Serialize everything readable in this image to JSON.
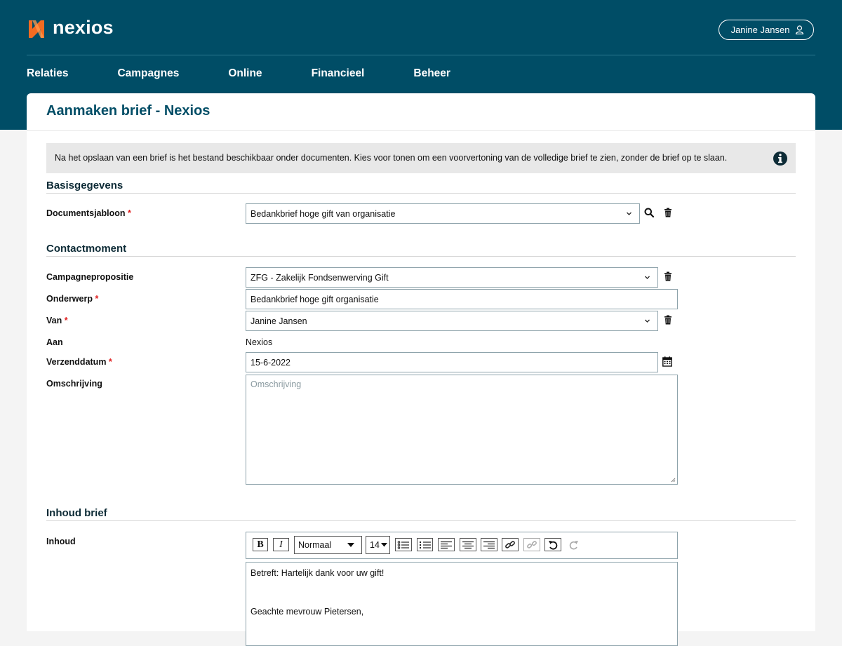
{
  "brand": {
    "name": "nexios",
    "accent": "#f26b21",
    "header_bg": "#004d66"
  },
  "user": {
    "name": "Janine Jansen",
    "icon": "user-icon"
  },
  "nav": [
    {
      "label": "Relaties"
    },
    {
      "label": "Campagnes"
    },
    {
      "label": "Online"
    },
    {
      "label": "Financieel"
    },
    {
      "label": "Beheer"
    }
  ],
  "page": {
    "title": "Aanmaken brief - Nexios"
  },
  "info": {
    "text": "Na het opslaan van een brief is het bestand beschikbaar onder documenten. Kies voor tonen om een voorvertoning van de volledige brief te zien, zonder de brief op te slaan.",
    "icon": "info-icon"
  },
  "sections": {
    "basis": "Basisgegevens",
    "contact": "Contactmoment",
    "inhoud": "Inhoud brief"
  },
  "fields": {
    "documentsjabloon": {
      "label": "Documentsjabloon",
      "required": "*",
      "value": "Bedankbrief hoge gift van organisatie"
    },
    "campagnepropositie": {
      "label": "Campagnepropositie",
      "value": "ZFG - Zakelijk Fondsenwerving Gift"
    },
    "onderwerp": {
      "label": "Onderwerp",
      "required": "*",
      "value": "Bedankbrief hoge gift organisatie"
    },
    "van": {
      "label": "Van",
      "required": "*",
      "value": "Janine Jansen"
    },
    "aan": {
      "label": "Aan",
      "value": "Nexios"
    },
    "verzenddatum": {
      "label": "Verzenddatum",
      "required": "*",
      "value": "15-6-2022"
    },
    "omschrijving": {
      "label": "Omschrijving",
      "placeholder": "Omschrijving"
    },
    "inhoud": {
      "label": "Inhoud"
    }
  },
  "editor": {
    "format": "Normaal",
    "size": "14",
    "lines": [
      "Betreft: Hartelijk dank voor uw gift!",
      "Geachte mevrouw Pietersen,"
    ]
  }
}
